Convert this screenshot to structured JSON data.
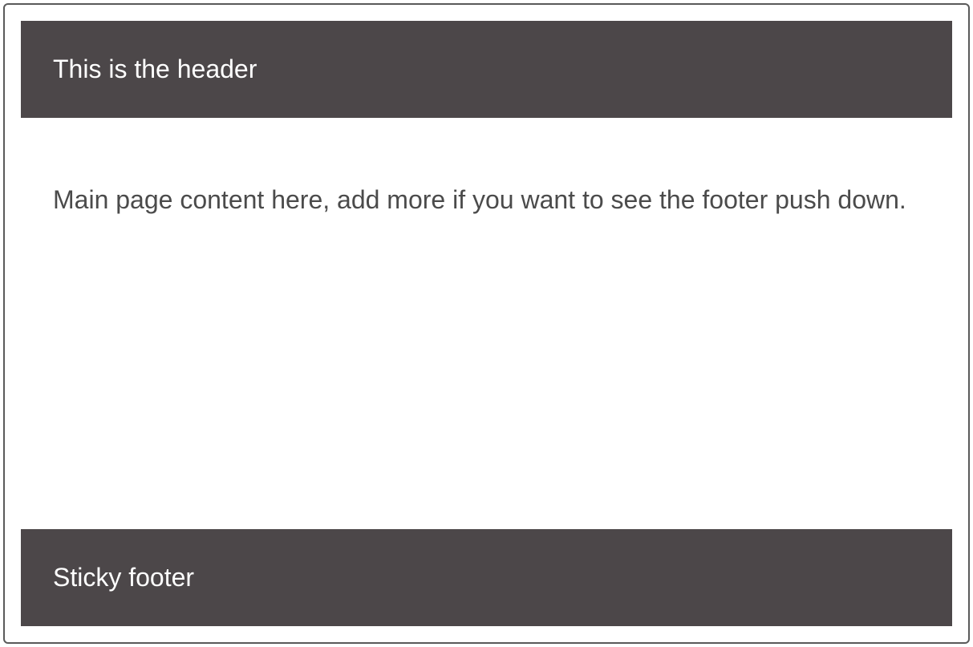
{
  "header": {
    "title": "This is the header"
  },
  "main": {
    "content": "Main page content here, add more if you want to see the footer push down."
  },
  "footer": {
    "label": "Sticky footer"
  }
}
